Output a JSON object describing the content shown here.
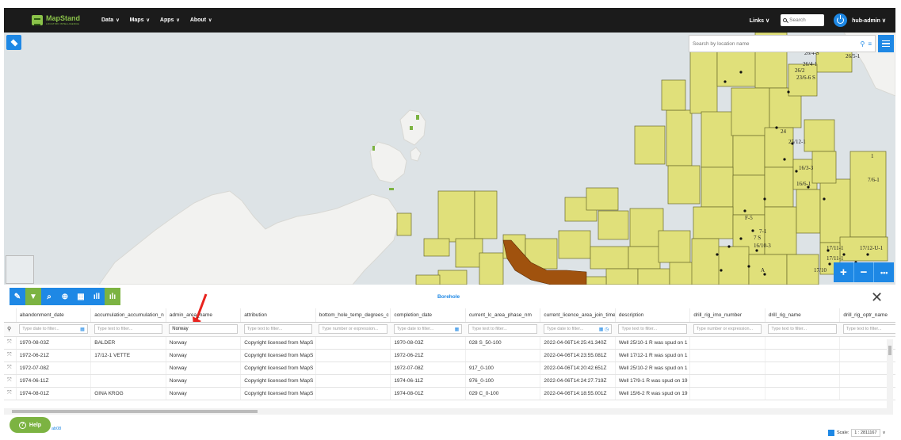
{
  "topbar": {
    "logo_name": "MapStand",
    "logo_sub": "LOCATION INTELLIGENCE",
    "nav": [
      "Data",
      "Maps",
      "Apps",
      "About"
    ],
    "links_label": "Links",
    "search_placeholder": "Search",
    "user": "hub-admin"
  },
  "map": {
    "location_search_placeholder": "Search by location name",
    "labels": [
      "26/4-S",
      "26/5-1",
      "26/4-1",
      "26/2",
      "23/6-6 S",
      "24",
      "25/12-1",
      "16/3-3",
      "16/6-1",
      "1",
      "7/6-1",
      "F-5",
      "7-1",
      "7 S",
      "16/10-3",
      "17/11-1",
      "17/12-U-1",
      "17/11-1",
      "17/10",
      "A"
    ],
    "colors": {
      "block": "#e0e07a",
      "block_border": "#6b6b2a",
      "field": "#a0520e",
      "land": "#f2f2f0",
      "sea": "#dde3e6"
    }
  },
  "toolbar": {
    "panel_title": "Borehole"
  },
  "table": {
    "columns": [
      "abandonment_date",
      "accumulation_accumulation_n",
      "admin_area_name",
      "attribution",
      "bottom_hole_temp_degrees_c",
      "completion_date",
      "current_lc_area_phase_nm",
      "current_licence_area_join_time",
      "description",
      "drill_rig_imo_number",
      "drill_rig_name",
      "drill_rig_optr_name"
    ],
    "filters": [
      "Type date to filter...",
      "Type text to filter...",
      "Norway",
      "Type text to filter...",
      "Type number or expression...",
      "Type date to filter...",
      "Type text to filter...",
      "Type date to filter...",
      "Type text to filter...",
      "Type number or expression...",
      "Type text to filter...",
      "Type text to filter..."
    ],
    "rows": [
      [
        "1970-08-03Z",
        "BALDER",
        "Norway",
        "Copyright licensed from MapS",
        "",
        "1970-08-03Z",
        "028 S_50-100",
        "2022-04-06T14:25:41.340Z",
        "Well 25/10-1 R was spud on 1",
        "",
        "",
        ""
      ],
      [
        "1972-06-21Z",
        "17/12-1 VETTE",
        "Norway",
        "Copyright licensed from MapS",
        "",
        "1972-06-21Z",
        "",
        "2022-04-06T14:23:55.081Z",
        "Well 17/12-1 R was spud on 1",
        "",
        "",
        ""
      ],
      [
        "1972-07-08Z",
        "",
        "Norway",
        "Copyright licensed from MapS",
        "",
        "1972-07-08Z",
        "917_0-100",
        "2022-04-06T14:20:42.651Z",
        "Well 25/10-2 R was spud on 1",
        "",
        "",
        ""
      ],
      [
        "1974-06-11Z",
        "",
        "Norway",
        "Copyright licensed from MapS",
        "",
        "1974-06-11Z",
        "976_0-100",
        "2022-04-06T14:24:27.719Z",
        "Well 17/9-1 R was spud on 19",
        "",
        "",
        ""
      ],
      [
        "1974-08-01Z",
        "GINA KROG",
        "Norway",
        "Copyright licensed from MapS",
        "",
        "1974-08-01Z",
        "029 C_0-100",
        "2022-04-06T14:18:55.001Z",
        "Well 15/6-2 R was spud on 19",
        "",
        "",
        ""
      ]
    ]
  },
  "footer": {
    "help_label": "Help",
    "link_text": "ab08",
    "scale_label": "Scale:",
    "scale_value": "1 : 2811167"
  }
}
